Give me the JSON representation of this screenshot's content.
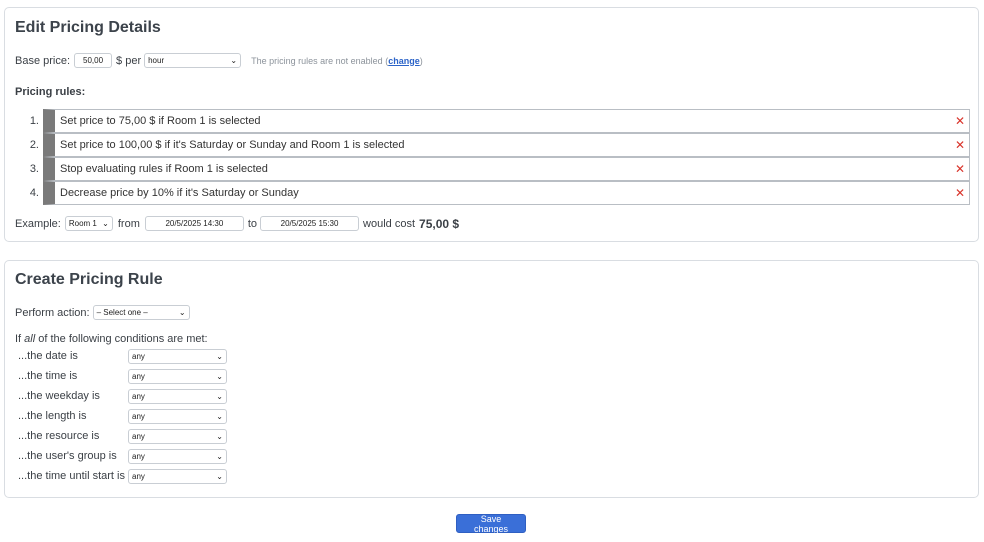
{
  "edit": {
    "title": "Edit Pricing Details",
    "base_price_label": "Base price:",
    "base_price_value": "50,00",
    "currency_per": "$ per",
    "unit_value": "hour",
    "rules_disabled_text": "The pricing rules are not enabled (",
    "change_link": "change",
    "rules_disabled_close": ")",
    "pricing_rules_label": "Pricing rules:",
    "rules": [
      {
        "num": "1.",
        "text": "Set price to 75,00 $ if Room 1 is selected"
      },
      {
        "num": "2.",
        "text": "Set price to 100,00 $ if it's Saturday or Sunday and Room 1 is selected"
      },
      {
        "num": "3.",
        "text": "Stop evaluating rules if Room 1 is selected"
      },
      {
        "num": "4.",
        "text": "Decrease price by 10% if it's Saturday or Sunday"
      }
    ],
    "delete_glyph": "✕",
    "example": {
      "label": "Example:",
      "resource": "Room 1",
      "from_label": "from",
      "from_value": "20/5/2025 14:30",
      "to_label": "to",
      "to_value": "20/5/2025 15:30",
      "would_cost": "would cost",
      "cost": "75,00 $"
    }
  },
  "create": {
    "title": "Create Pricing Rule",
    "perform_action_label": "Perform action:",
    "action_value": "– Select one –",
    "conditions_intro_pre": "If ",
    "conditions_intro_em": "all",
    "conditions_intro_post": " of the following conditions are met:",
    "conditions": [
      {
        "label": "...the date is",
        "value": "any"
      },
      {
        "label": "...the time is",
        "value": "any"
      },
      {
        "label": "...the weekday is",
        "value": "any"
      },
      {
        "label": "...the length is",
        "value": "any"
      },
      {
        "label": "...the resource is",
        "value": "any"
      },
      {
        "label": "...the user's group is",
        "value": "any"
      },
      {
        "label": "...the time until start is",
        "value": "any"
      }
    ]
  },
  "save_label": "Save changes",
  "icons": {
    "dropdown": "chevron-down-icon",
    "delete": "close-icon"
  },
  "colors": {
    "accent": "#3a6fd8",
    "delete": "#d9342b",
    "rule_bar": "#7a7a7a"
  }
}
